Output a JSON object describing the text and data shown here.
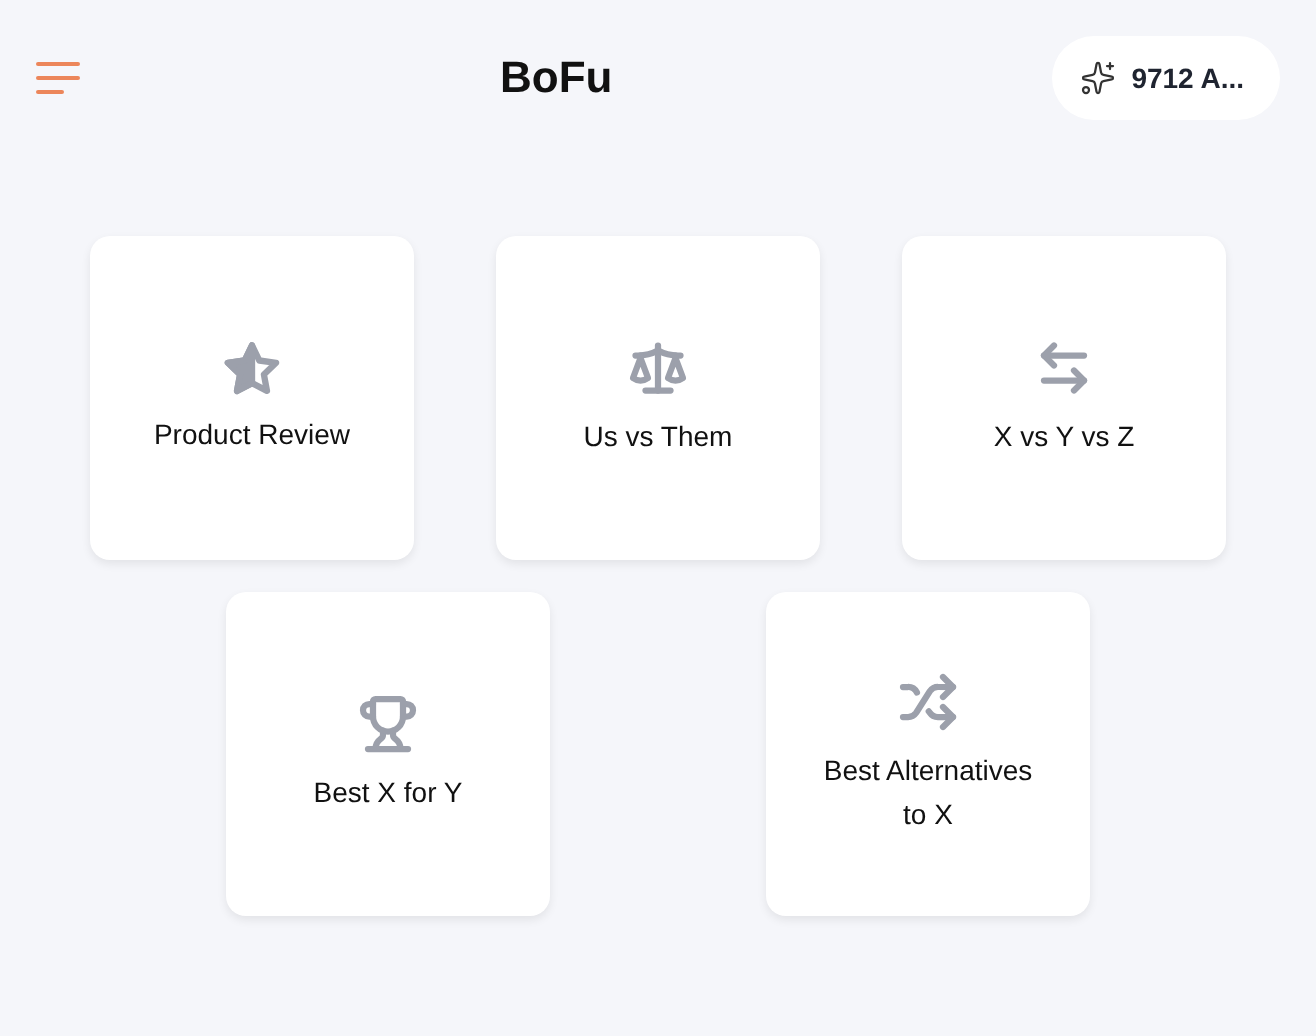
{
  "header": {
    "title": "BoFu",
    "credits": "9712 A..."
  },
  "card_rows": [
    [
      {
        "kind": "star",
        "label": "Product Review"
      },
      {
        "kind": "scale",
        "label": "Us vs Them"
      },
      {
        "kind": "swap",
        "label": "X vs Y vs Z"
      }
    ],
    [
      {
        "kind": "trophy",
        "label": "Best X for Y"
      },
      {
        "kind": "shuffle",
        "label": "Best Alternatives to X"
      }
    ]
  ]
}
